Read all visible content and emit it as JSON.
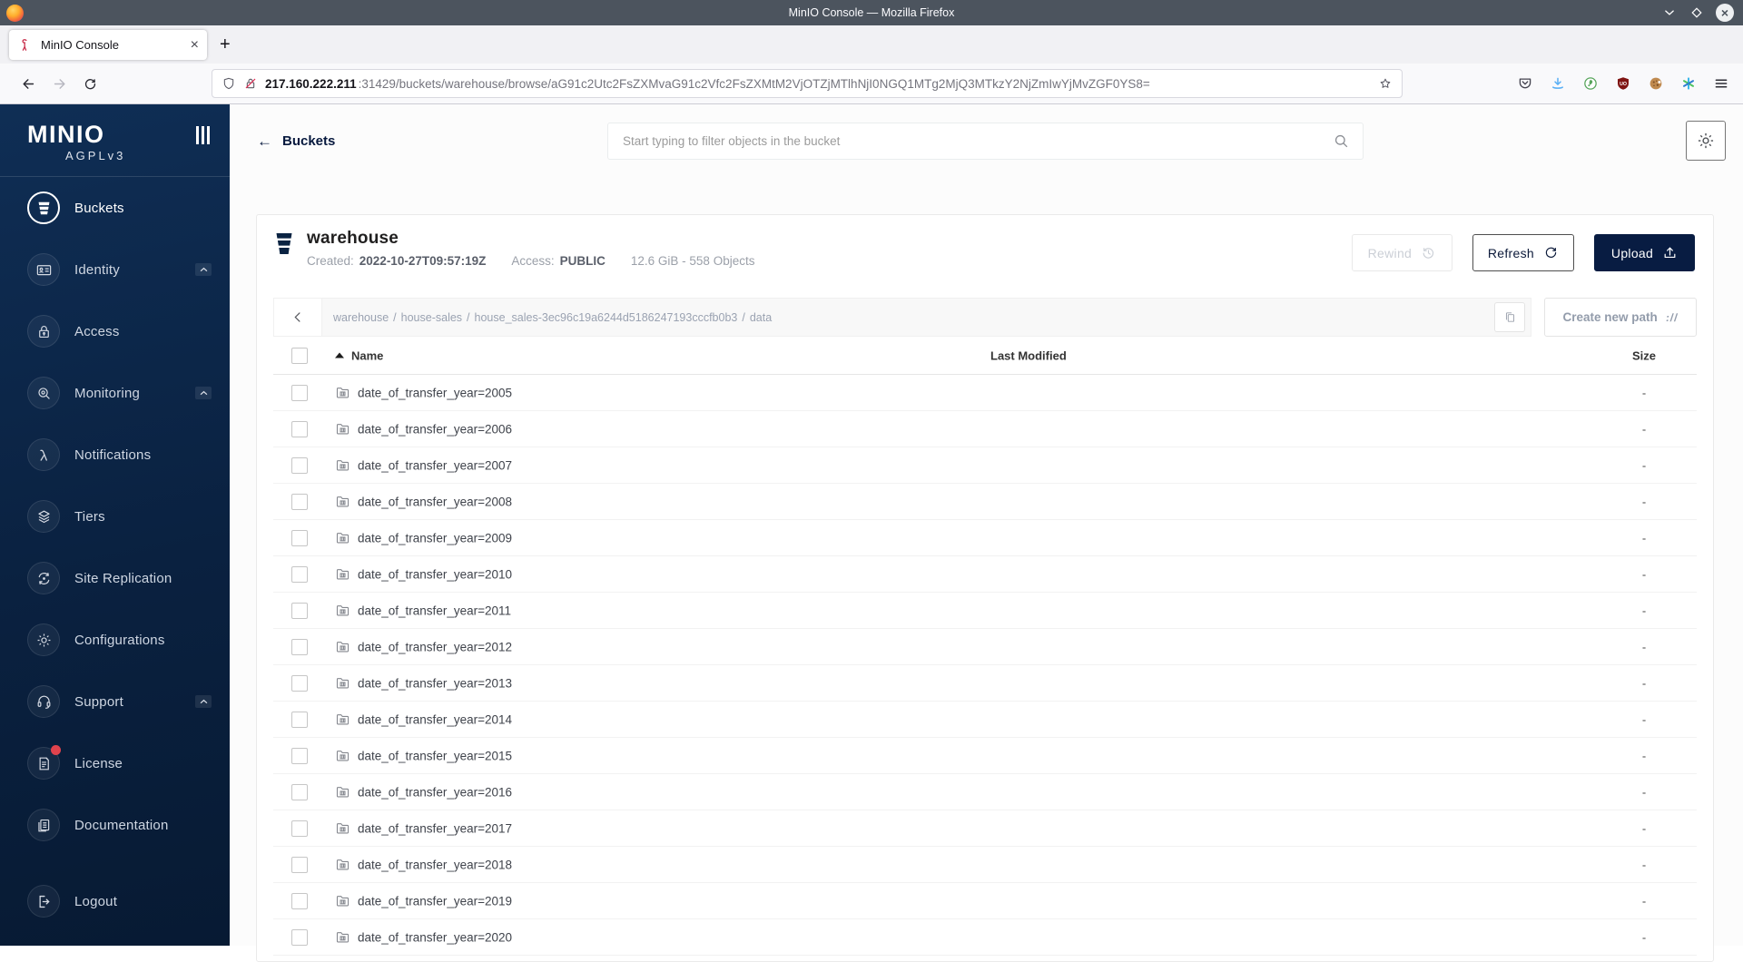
{
  "colors": {
    "accent_navy": "#081C42",
    "sidebar_top": "#0F2E55",
    "sidebar_bottom": "#071A33",
    "license_badge_red": "#E0434D",
    "downloads_blue": "#57AEF5",
    "titlebar_gray": "#4C545E"
  },
  "browser": {
    "window_title": "MinIO Console — Mozilla Firefox",
    "window_controls": [
      "chevron-down-icon",
      "maximize-diamond-icon",
      "close-circle-icon"
    ],
    "tab": {
      "favicon": "minio-bird-icon",
      "title": "MinIO Console",
      "close_glyph": "×"
    },
    "new_tab_glyph": "+",
    "nav_icons": [
      "back-arrow-icon",
      "forward-arrow-icon",
      "reload-icon"
    ],
    "url": {
      "shield": "tracking-shield-icon",
      "lock": "insecure-lock-icon",
      "host": "217.160.222.211",
      "rest": ":31429/buckets/warehouse/browse/aG91c2Utc2FsZXMvaG91c2Vfc2FsZXMtM2VjOTZjMTlhNjI0NGQ1MTg2MjQ3MTkzY2NjZmIwYjMvZGF0YS8=",
      "bookmark": "star-icon"
    },
    "toolbar_icons": [
      "pocket-icon",
      "downloads-icon",
      "extension-green-icon",
      "ublock-origin-icon",
      "cookie-extension-icon",
      "colorful-asterisk-extension-icon",
      "hamburger-menu-icon"
    ]
  },
  "sidebar": {
    "logo_text": "MINIO",
    "license_text": "AGPLv3",
    "collapse_icon": "sidebar-collapse-icon",
    "items": [
      {
        "label": "Buckets",
        "icon": "bucket-icon",
        "active": true
      },
      {
        "label": "Identity",
        "icon": "identity-card-icon",
        "expandable": true
      },
      {
        "label": "Access",
        "icon": "lock-icon"
      },
      {
        "label": "Monitoring",
        "icon": "monitoring-search-icon",
        "expandable": true
      },
      {
        "label": "Notifications",
        "icon": "lambda-icon"
      },
      {
        "label": "Tiers",
        "icon": "tiers-layers-icon"
      },
      {
        "label": "Site Replication",
        "icon": "replication-arrows-icon"
      },
      {
        "label": "Configurations",
        "icon": "gear-icon"
      },
      {
        "label": "Support",
        "icon": "support-headset-icon",
        "expandable": true
      },
      {
        "label": "License",
        "icon": "license-document-icon",
        "badge": true
      },
      {
        "label": "Documentation",
        "icon": "documentation-pages-icon"
      },
      {
        "label": "Logout",
        "icon": "logout-icon"
      }
    ]
  },
  "page_header": {
    "back_label": "Buckets",
    "back_arrow_glyph": "←",
    "search_placeholder": "Start typing to filter objects in the bucket",
    "search_icon": "search-magnifier-icon",
    "settings_icon": "gear-icon"
  },
  "bucket": {
    "icon": "bucket-solid-icon",
    "name": "warehouse",
    "created_label": "Created:",
    "created_value": "2022-10-27T09:57:19Z",
    "access_label": "Access:",
    "access_value": "PUBLIC",
    "summary": "12.6 GiB - 558 Objects",
    "actions": {
      "rewind": {
        "label": "Rewind",
        "icon": "rewind-history-icon",
        "disabled": true
      },
      "refresh": {
        "label": "Refresh",
        "icon": "refresh-icon"
      },
      "upload": {
        "label": "Upload",
        "icon": "upload-icon"
      }
    }
  },
  "browse": {
    "back_icon": "chevron-left-icon",
    "path_segments": [
      "warehouse",
      "house-sales",
      "house_sales-3ec96c19a6244d5186247193cccfb0b3",
      "data"
    ],
    "separator": "/",
    "copy_icon": "copy-path-icon",
    "create_path_label": "Create new path",
    "create_path_icon": "://"
  },
  "table": {
    "headers": {
      "name": "Name",
      "modified": "Last Modified",
      "size": "Size"
    },
    "sort": {
      "column": "Name",
      "direction": "asc"
    },
    "rows": [
      {
        "icon": "folder-icon",
        "name": "date_of_transfer_year=2005",
        "modified": "",
        "size": "-"
      },
      {
        "icon": "folder-icon",
        "name": "date_of_transfer_year=2006",
        "modified": "",
        "size": "-"
      },
      {
        "icon": "folder-icon",
        "name": "date_of_transfer_year=2007",
        "modified": "",
        "size": "-"
      },
      {
        "icon": "folder-icon",
        "name": "date_of_transfer_year=2008",
        "modified": "",
        "size": "-"
      },
      {
        "icon": "folder-icon",
        "name": "date_of_transfer_year=2009",
        "modified": "",
        "size": "-"
      },
      {
        "icon": "folder-icon",
        "name": "date_of_transfer_year=2010",
        "modified": "",
        "size": "-"
      },
      {
        "icon": "folder-icon",
        "name": "date_of_transfer_year=2011",
        "modified": "",
        "size": "-"
      },
      {
        "icon": "folder-icon",
        "name": "date_of_transfer_year=2012",
        "modified": "",
        "size": "-"
      },
      {
        "icon": "folder-icon",
        "name": "date_of_transfer_year=2013",
        "modified": "",
        "size": "-"
      },
      {
        "icon": "folder-icon",
        "name": "date_of_transfer_year=2014",
        "modified": "",
        "size": "-"
      },
      {
        "icon": "folder-icon",
        "name": "date_of_transfer_year=2015",
        "modified": "",
        "size": "-"
      },
      {
        "icon": "folder-icon",
        "name": "date_of_transfer_year=2016",
        "modified": "",
        "size": "-"
      },
      {
        "icon": "folder-icon",
        "name": "date_of_transfer_year=2017",
        "modified": "",
        "size": "-"
      },
      {
        "icon": "folder-icon",
        "name": "date_of_transfer_year=2018",
        "modified": "",
        "size": "-"
      },
      {
        "icon": "folder-icon",
        "name": "date_of_transfer_year=2019",
        "modified": "",
        "size": "-"
      },
      {
        "icon": "folder-icon",
        "name": "date_of_transfer_year=2020",
        "modified": "",
        "size": "-"
      }
    ]
  }
}
